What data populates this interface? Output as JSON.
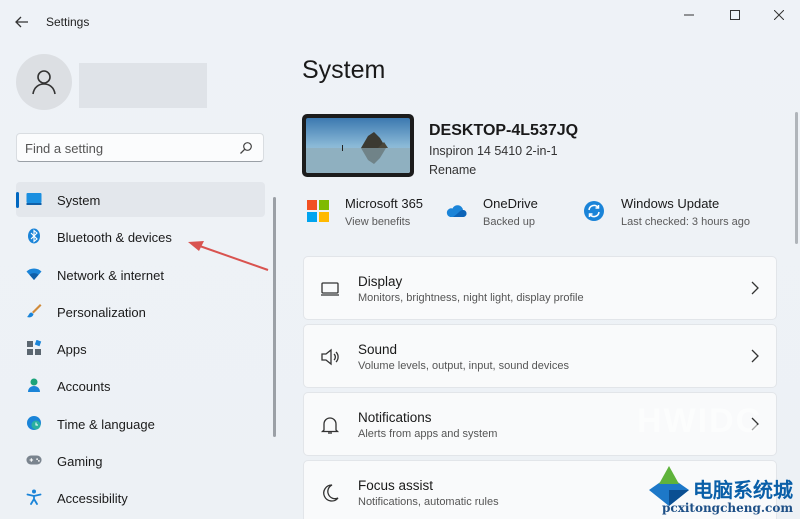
{
  "window": {
    "title": "Settings",
    "back_icon": "back-arrow-icon",
    "controls": [
      "minimize-icon",
      "maximize-icon",
      "close-icon"
    ]
  },
  "search": {
    "placeholder": "Find a setting"
  },
  "sidebar": {
    "items": [
      {
        "label": "System",
        "icon": "system-icon",
        "active": true
      },
      {
        "label": "Bluetooth & devices",
        "icon": "bluetooth-icon"
      },
      {
        "label": "Network & internet",
        "icon": "wifi-icon"
      },
      {
        "label": "Personalization",
        "icon": "brush-icon"
      },
      {
        "label": "Apps",
        "icon": "apps-icon"
      },
      {
        "label": "Accounts",
        "icon": "person-icon"
      },
      {
        "label": "Time & language",
        "icon": "globe-clock-icon"
      },
      {
        "label": "Gaming",
        "icon": "gamepad-icon"
      },
      {
        "label": "Accessibility",
        "icon": "accessibility-icon"
      }
    ]
  },
  "main": {
    "title": "System",
    "device": {
      "name": "DESKTOP-4L537JQ",
      "model": "Inspiron 14 5410 2-in-1",
      "rename": "Rename"
    },
    "quick": [
      {
        "title": "Microsoft 365",
        "sub": "View benefits",
        "icon": "microsoft-365-icon"
      },
      {
        "title": "OneDrive",
        "sub": "Backed up",
        "icon": "onedrive-icon"
      },
      {
        "title": "Windows Update",
        "sub": "Last checked: 3 hours ago",
        "icon": "windows-update-icon"
      }
    ],
    "cards": [
      {
        "title": "Display",
        "sub": "Monitors, brightness, night light, display profile",
        "icon": "display-icon"
      },
      {
        "title": "Sound",
        "sub": "Volume levels, output, input, sound devices",
        "icon": "speaker-icon"
      },
      {
        "title": "Notifications",
        "sub": "Alerts from apps and system",
        "icon": "bell-icon"
      },
      {
        "title": "Focus assist",
        "sub": "Notifications, automatic rules",
        "icon": "moon-icon"
      }
    ]
  },
  "watermark": {
    "hwidc": "HWIDC",
    "cn": "电脑系统城",
    "url": "pcxitongcheng.com"
  },
  "colors": {
    "accent": "#0067c0",
    "annotation_arrow": "#d9534f"
  }
}
